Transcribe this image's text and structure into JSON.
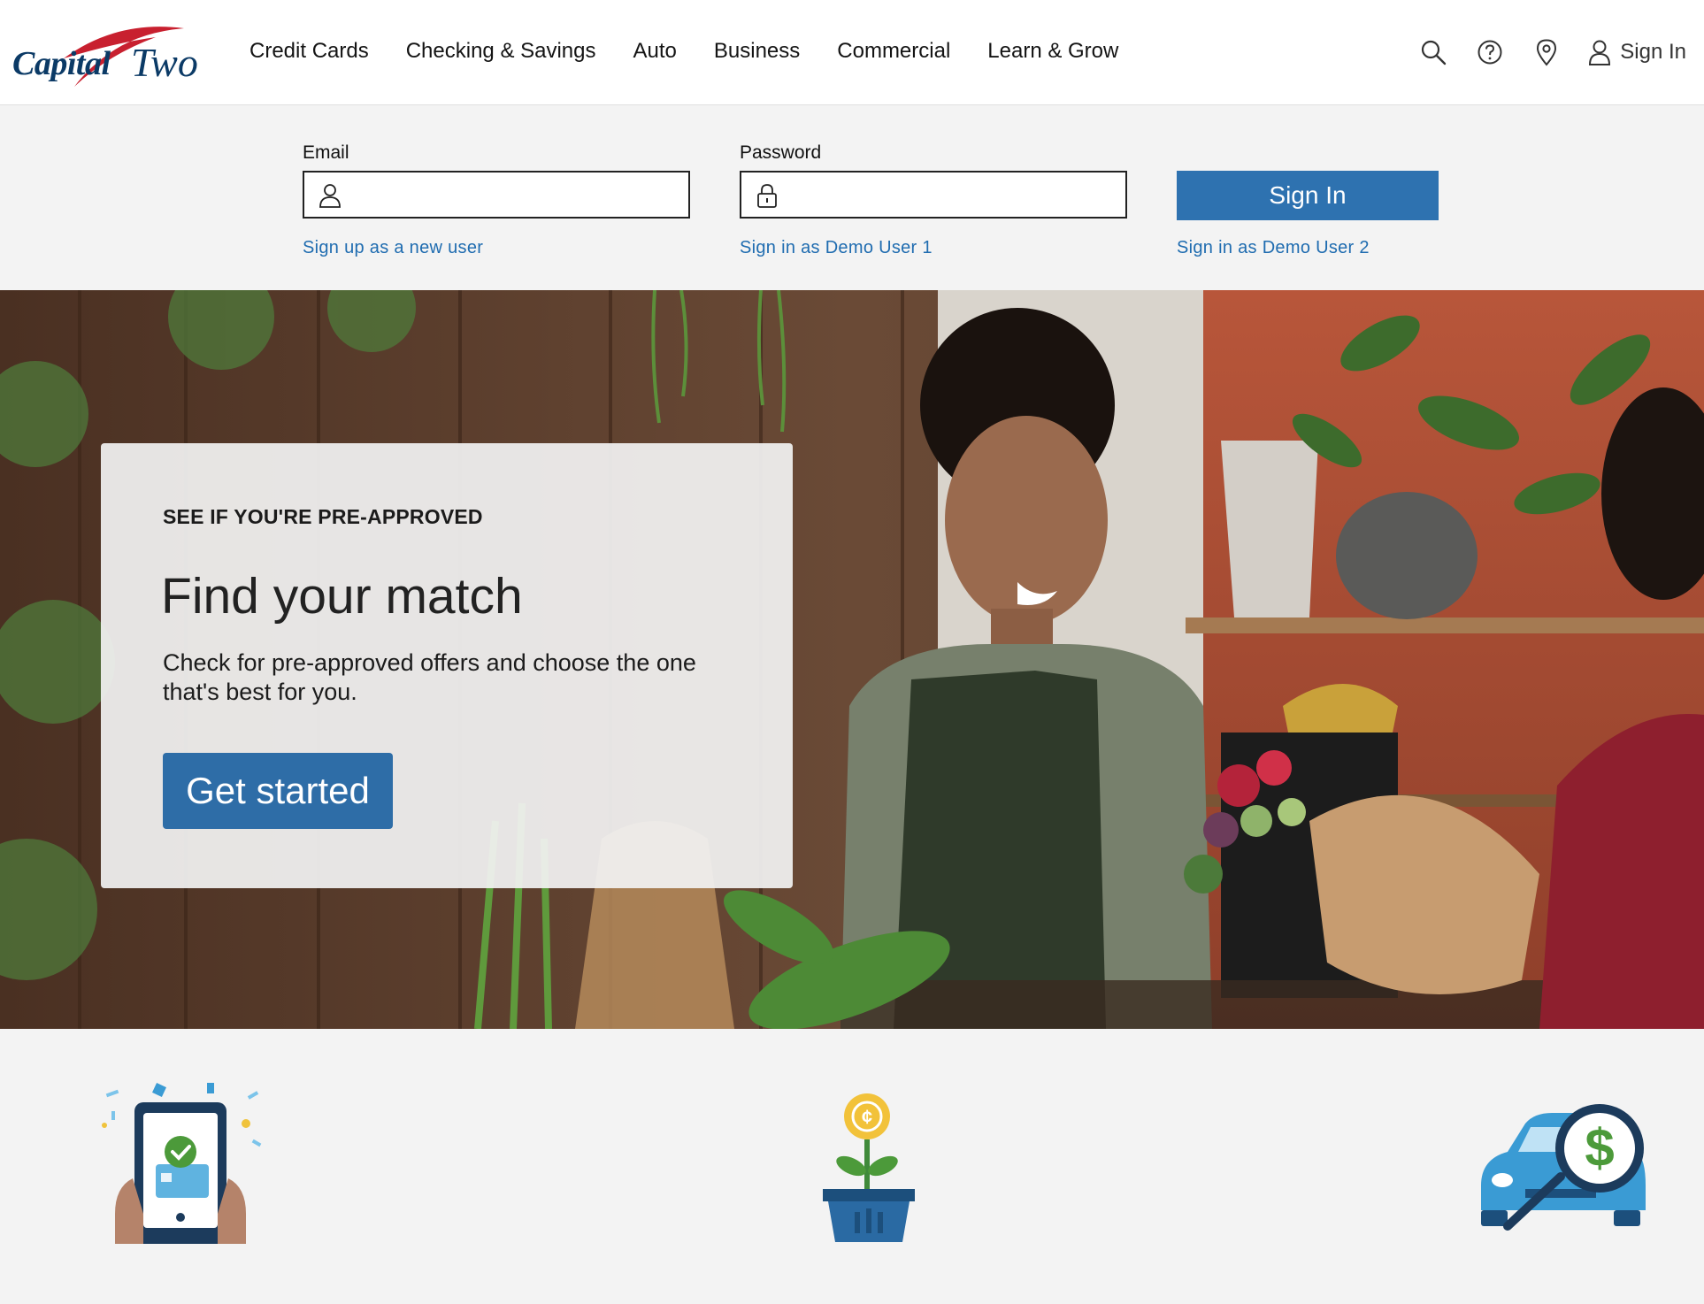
{
  "brand": {
    "logo_prefix": "Capital",
    "logo_suffix": "Two"
  },
  "nav": {
    "items": [
      "Credit Cards",
      "Checking & Savings",
      "Auto",
      "Business",
      "Commercial",
      "Learn & Grow"
    ]
  },
  "utilities": {
    "icons": [
      "search-icon",
      "help-icon",
      "location-pin-icon",
      "user-icon"
    ],
    "sign_in_label": "Sign In"
  },
  "login": {
    "email_label": "Email",
    "email_value": "",
    "password_label": "Password",
    "password_value": "",
    "sign_in_button": "Sign In",
    "signup_link": "Sign up as a new user",
    "demo_user_1_link": "Sign in as Demo User 1",
    "demo_user_2_link": "Sign in as Demo User 2"
  },
  "hero": {
    "eyebrow": "SEE IF YOU'RE PRE-APPROVED",
    "title": "Find your match",
    "description": "Check for pre-approved offers and choose the one that's best for you.",
    "cta": "Get started"
  },
  "features": {
    "icons": [
      "phone-approval-icon",
      "money-plant-icon",
      "car-price-search-icon"
    ]
  },
  "colors": {
    "primary_button": "#2e72b0",
    "link": "#1f6cb0",
    "brand_navy": "#0b3a66",
    "brand_red": "#c8202f"
  }
}
